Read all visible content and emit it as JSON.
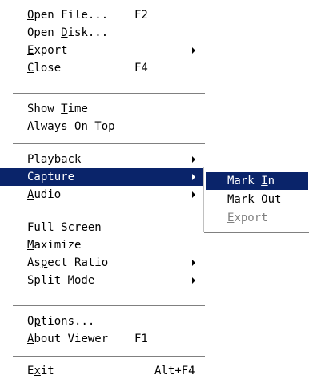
{
  "main_menu": {
    "items": [
      {
        "prefix": "",
        "accel": "O",
        "suffix": "pen File...",
        "shortcut": "F2"
      },
      {
        "prefix": "Open ",
        "accel": "D",
        "suffix": "isk...",
        "shortcut": ""
      },
      {
        "prefix": "",
        "accel": "E",
        "suffix": "xport",
        "shortcut": ""
      },
      {
        "prefix": "",
        "accel": "C",
        "suffix": "lose",
        "shortcut": "F4"
      },
      {
        "prefix": "Show ",
        "accel": "T",
        "suffix": "ime",
        "shortcut": ""
      },
      {
        "prefix": "Always ",
        "accel": "O",
        "suffix": "n Top",
        "shortcut": ""
      },
      {
        "prefix": "Playback",
        "accel": "",
        "suffix": "",
        "shortcut": ""
      },
      {
        "prefix": "Capture",
        "accel": "",
        "suffix": "",
        "shortcut": ""
      },
      {
        "prefix": "",
        "accel": "A",
        "suffix": "udio",
        "shortcut": ""
      },
      {
        "prefix": "Full S",
        "accel": "c",
        "suffix": "reen",
        "shortcut": ""
      },
      {
        "prefix": "",
        "accel": "M",
        "suffix": "aximize",
        "shortcut": ""
      },
      {
        "prefix": "As",
        "accel": "p",
        "suffix": "ect Ratio",
        "shortcut": ""
      },
      {
        "prefix": "Split Mode",
        "accel": "",
        "suffix": "",
        "shortcut": ""
      },
      {
        "prefix": "O",
        "accel": "p",
        "suffix": "tions...",
        "shortcut": ""
      },
      {
        "prefix": "",
        "accel": "A",
        "suffix": "bout Viewer",
        "shortcut": "F1"
      },
      {
        "prefix": "E",
        "accel": "x",
        "suffix": "it",
        "shortcut": "Alt+F4"
      }
    ]
  },
  "capture_submenu": {
    "items": [
      {
        "prefix": "Mark ",
        "accel": "I",
        "suffix": "n"
      },
      {
        "prefix": "Mark ",
        "accel": "O",
        "suffix": "ut"
      },
      {
        "prefix": "",
        "accel": "E",
        "suffix": "xport"
      }
    ]
  },
  "colors": {
    "selection": "#0a246a",
    "disabled_text": "#808080"
  }
}
